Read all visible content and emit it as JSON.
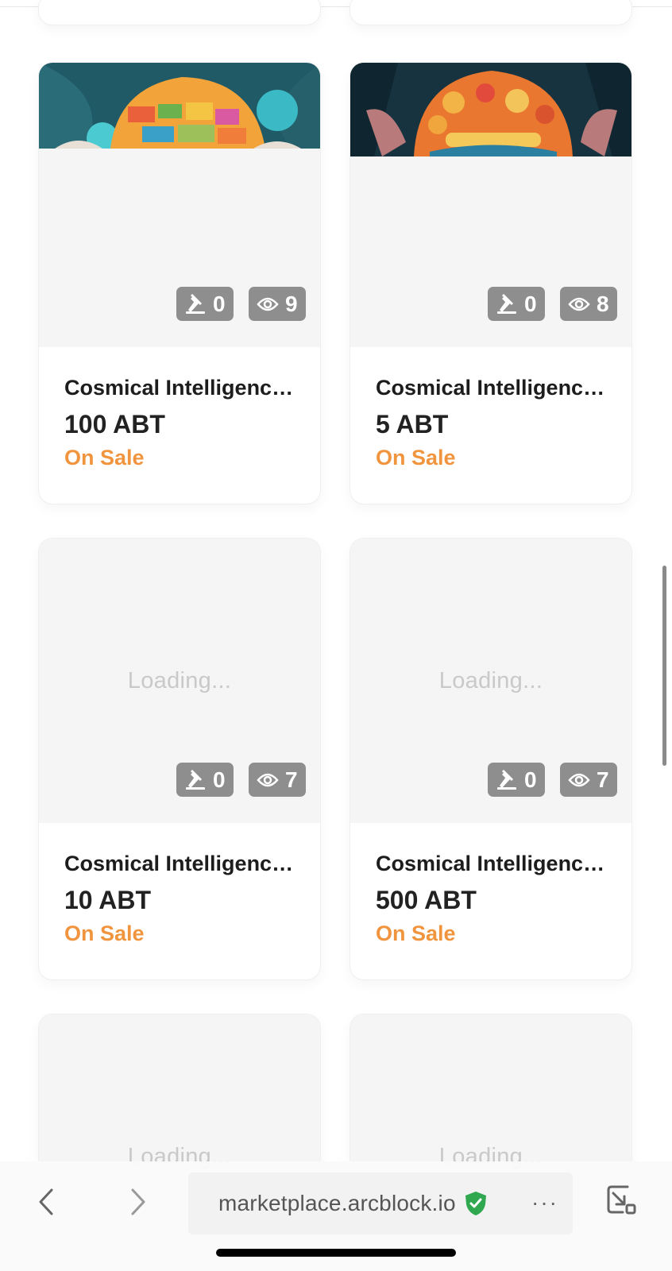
{
  "cards": [
    {
      "title": "Cosmical Intelligence...",
      "price": "100 ABT",
      "status": "On Sale",
      "bids": "0",
      "views": "9",
      "media": "image"
    },
    {
      "title": "Cosmical Intelligence...",
      "price": "5 ABT",
      "status": "On Sale",
      "bids": "0",
      "views": "8",
      "media": "image"
    },
    {
      "title": "Cosmical Intelligence...",
      "price": "10 ABT",
      "status": "On Sale",
      "bids": "0",
      "views": "7",
      "media": "loading"
    },
    {
      "title": "Cosmical Intelligence...",
      "price": "500 ABT",
      "status": "On Sale",
      "bids": "0",
      "views": "7",
      "media": "loading"
    }
  ],
  "loading_text": "Loading...",
  "browser": {
    "url": "marketplace.arcblock.io",
    "back_icon": "chevron-left-icon",
    "forward_icon": "chevron-right-icon",
    "secure_icon": "shield-check-icon",
    "more_label": "···",
    "minimize_icon": "minimize-window-icon"
  },
  "colors": {
    "status": "#f0953e",
    "pill": "#8e8e8e",
    "secure": "#2fa84f"
  }
}
